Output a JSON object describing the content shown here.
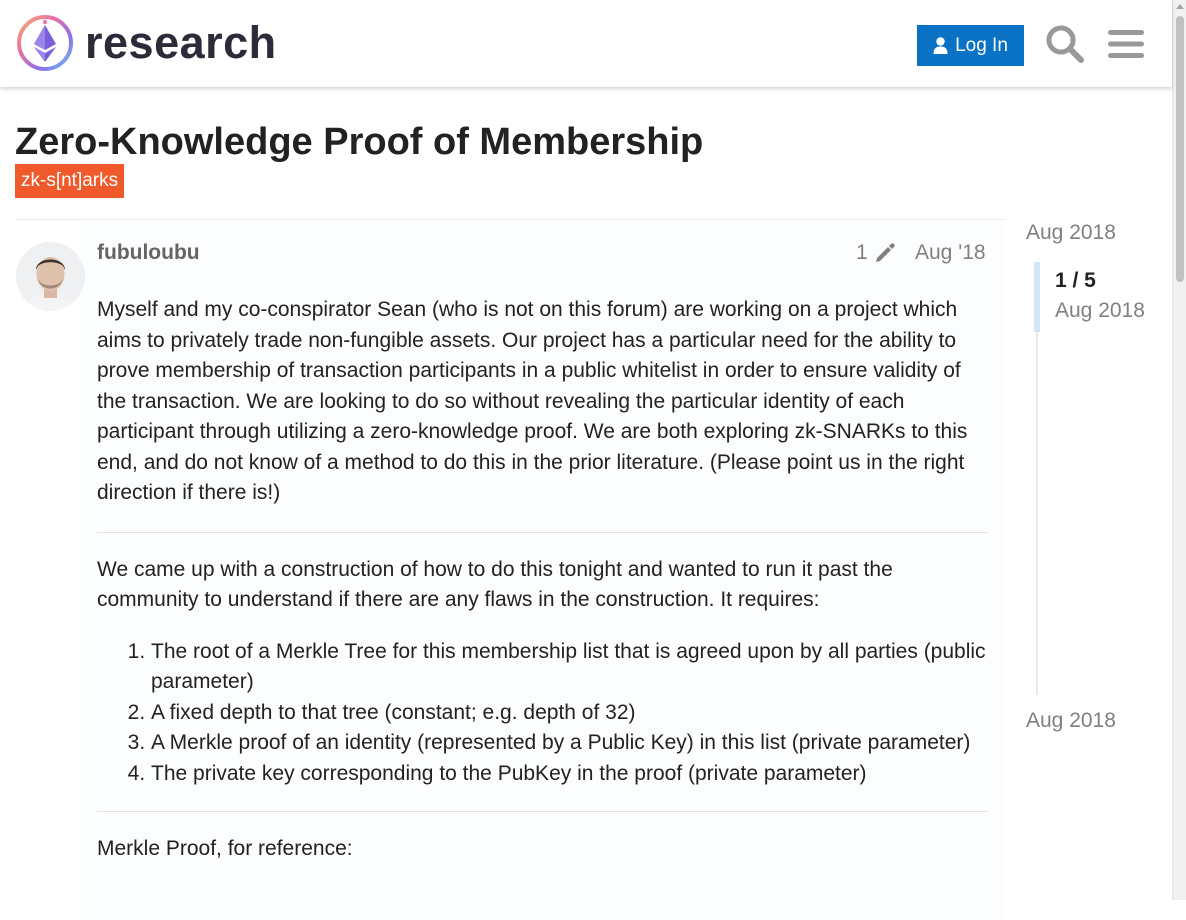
{
  "header": {
    "logo_text": "research",
    "login_label": "Log In",
    "icons": [
      "logo-icon",
      "user-icon",
      "search-icon",
      "hamburger-menu-icon"
    ]
  },
  "topic": {
    "title": "Zero-Knowledge Proof of Membership",
    "category": "zk-s[nt]arks",
    "category_color": "#f05a2a"
  },
  "post": {
    "author": "fubuloubu",
    "edit_count": "1",
    "date": "Aug '18",
    "paragraph1": "Myself and my co-conspirator Sean (who is not on this forum) are working on a project which aims to privately trade non-fungible assets. Our project has a particular need for the ability to prove membership of transaction participants in a public whitelist in order to ensure validity of the transaction. We are looking to do so without revealing the particular identity of each participant through utilizing a zero-knowledge proof. We are both exploring zk-SNARKs to this end, and do not know of a method to do this in the prior literature. (Please point us in the right direction if there is!)",
    "paragraph2": "We came up with a construction of how to do this tonight and wanted to run it past the community to understand if there are any flaws in the construction. It requires:",
    "requirements": [
      "The root of a Merkle Tree for this membership list that is agreed upon by all parties (public parameter)",
      "A fixed depth to that tree (constant; e.g. depth of 32)",
      "A Merkle proof of an identity (represented by a Public Key) in this list (private parameter)",
      "The private key corresponding to the PubKey in the proof (private parameter)"
    ],
    "paragraph3": "Merkle Proof, for reference:"
  },
  "timeline": {
    "start_date": "Aug 2018",
    "position": "1 / 5",
    "position_date": "Aug 2018",
    "end_date": "Aug 2018"
  },
  "colors": {
    "accent": "#0a72c4",
    "badge": "#f05a2a",
    "timeline_handle": "#d1e7f8"
  }
}
